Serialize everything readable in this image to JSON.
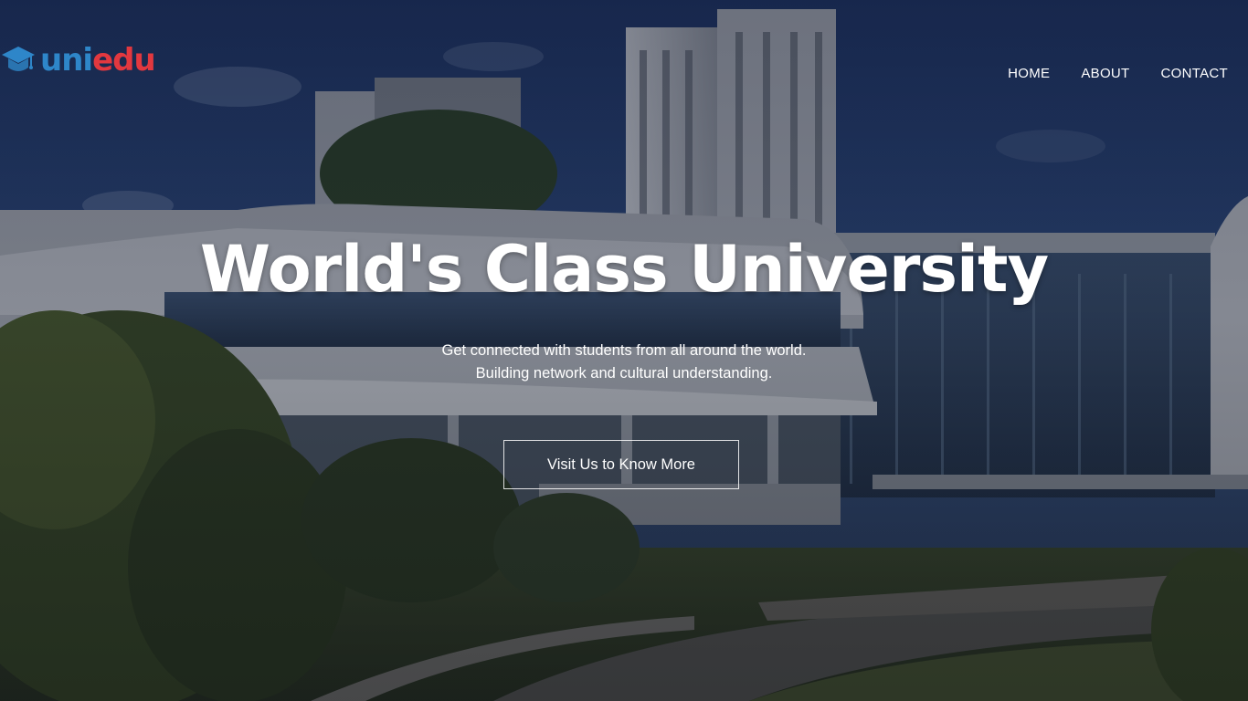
{
  "logo": {
    "part1": "uni",
    "part2": "edu",
    "icon": "graduation-cap-icon",
    "colors": {
      "uni": "#2e86c9",
      "edu": "#e2383f"
    }
  },
  "nav": {
    "items": [
      "HOME",
      "ABOUT",
      "CONTACT"
    ]
  },
  "hero": {
    "title": "World's Class University",
    "subtitle_line1": "Get connected with students from all around the world.",
    "subtitle_line2": "Building network and cultural understanding.",
    "cta_label": "Visit Us to Know More"
  }
}
